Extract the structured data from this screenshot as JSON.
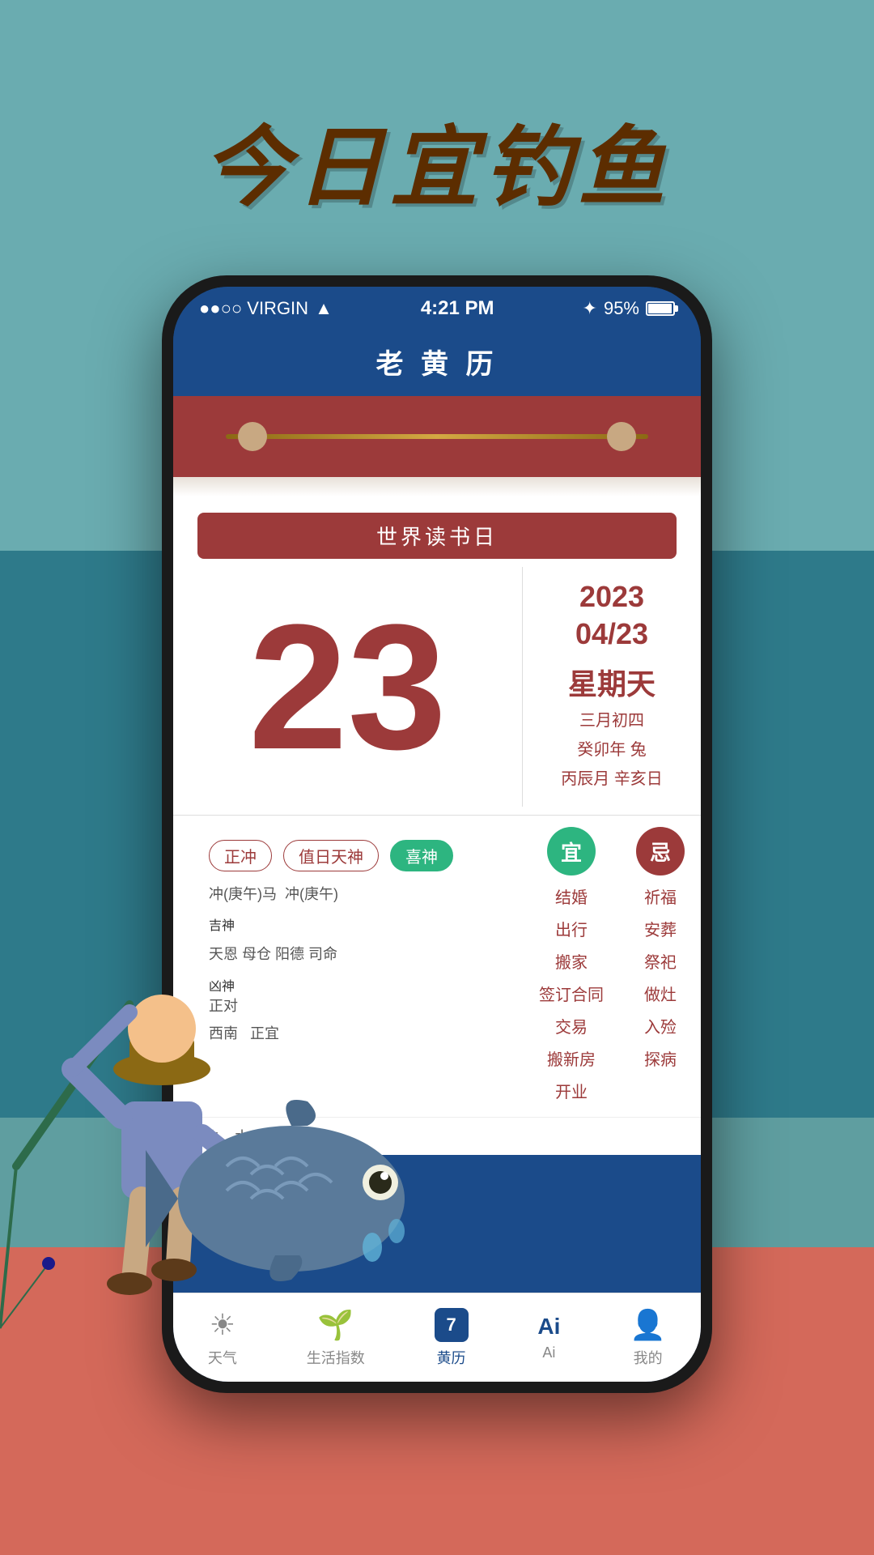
{
  "background": {
    "top_color": "#6aacb0",
    "ocean_color": "#2e7a8a",
    "sand_color": "#e8d5b0",
    "bottom_color": "#d4695a"
  },
  "title": "今日宜钓鱼",
  "phone": {
    "status_bar": {
      "carrier": "●●○○ VIRGIN",
      "wifi": "WiFi",
      "time": "4:21 PM",
      "battery_percent": "95%"
    },
    "app_title": "老 黄 历",
    "calendar": {
      "holiday": "世界读书日",
      "day": "23",
      "year": "2023",
      "month_day": "04/23",
      "weekday": "星期天",
      "lunar_line1": "三月初四",
      "lunar_line2": "癸卯年 兔",
      "lunar_line3": "丙辰月 辛亥日",
      "yi_label": "宜",
      "ji_label": "忌",
      "yi_items": [
        "结婚",
        "出行",
        "搬家",
        "签订合同",
        "交易",
        "搬新房",
        "开业"
      ],
      "ji_items": [
        "祈福",
        "安葬",
        "祭祀",
        "做灶",
        "入殓",
        "探病"
      ],
      "tags": [
        {
          "label": "正冲",
          "highlight": false
        },
        {
          "label": "值日天神",
          "highlight": false
        },
        {
          "label": "喜神",
          "highlight": true
        }
      ],
      "chong_left": "冲(庚午)马",
      "chong_right": "冲(庚午)",
      "sections": [
        {
          "label": "吉神",
          "values": [
            "天恩",
            "母仓",
            "阳德",
            "司命"
          ]
        },
        {
          "label": "凶神",
          "values": [
            "正对"
          ]
        }
      ],
      "direction": "东北",
      "water_direction": "水",
      "lucky_animal": "羊",
      "position_label": "正宜",
      "direction_label": "西南"
    },
    "bottom_nav": [
      {
        "label": "天气",
        "icon": "☀",
        "active": false
      },
      {
        "label": "生活指数",
        "icon": "🌱",
        "active": false
      },
      {
        "label": "黄历",
        "icon": "7",
        "active": true
      },
      {
        "label": "Ai",
        "icon": "Ai",
        "active": false
      },
      {
        "label": "我的",
        "icon": "👤",
        "active": false
      }
    ]
  }
}
